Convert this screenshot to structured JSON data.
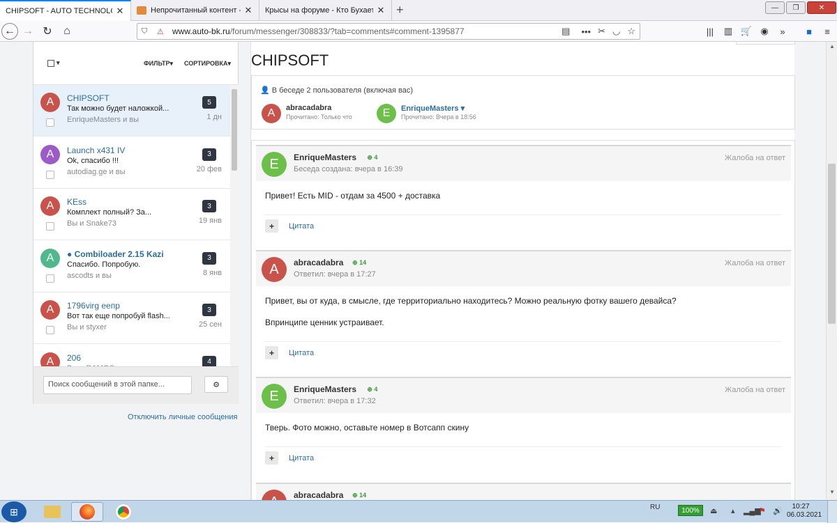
{
  "browser": {
    "tabs": [
      {
        "label": "CHIPSOFT - AUTO TECHNOLOGY",
        "active": true
      },
      {
        "label": "Непрочитанный контент - Фо",
        "active": false
      },
      {
        "label": "Крысы на форуме - Кто Бухает то",
        "active": false
      }
    ],
    "url_host": "www.auto-bk.ru",
    "url_path": "/forum/messenger/308833/?tab=comments#comment-1395877"
  },
  "sidebar": {
    "filter_label": "ФИЛЬТР",
    "sort_label": "СОРТИРОВКА",
    "conversations": [
      {
        "title": "CHIPSOFT",
        "excerpt": "Так можно будет наложкой...",
        "participants": "EnriqueMasters и вы",
        "count": "5",
        "date": "1 дн",
        "avatar": "A",
        "avatar_color": "#c9524a",
        "selected": true,
        "unread": false
      },
      {
        "title": "Launch x431 IV",
        "excerpt": "Ok, спасибо !!!",
        "participants": "autodiag.ge и вы",
        "count": "3",
        "date": "20 фев",
        "avatar": "A",
        "avatar_color": "#9c5bc8",
        "selected": false,
        "unread": false
      },
      {
        "title": "KEss",
        "excerpt": "Комплект полный? За...",
        "participants": "Вы и Snake73",
        "count": "3",
        "date": "19 янв",
        "avatar": "A",
        "avatar_color": "#c9524a",
        "selected": false,
        "unread": false
      },
      {
        "title": "● Combiloader 2.15 Kazi",
        "excerpt": "Спасибо. Попробую.",
        "participants": "ascodts и вы",
        "count": "3",
        "date": "8 янв",
        "avatar": "A",
        "avatar_color": "#4fb88c",
        "selected": false,
        "unread": true
      },
      {
        "title": "1796virg еепр",
        "excerpt": "Вот так еще попробуй flash...",
        "participants": "Вы и styxer",
        "count": "3",
        "date": "25 сен",
        "avatar": "A",
        "avatar_color": "#c9524a",
        "selected": false,
        "unread": false
      },
      {
        "title": "206",
        "excerpt": "",
        "participants": "Вы и RAMOS",
        "count": "4",
        "date": "",
        "avatar": "A",
        "avatar_color": "#c9524a",
        "selected": false,
        "unread": false
      }
    ],
    "search_placeholder": "Поиск сообщений в этой папке...",
    "disable_link": "Отключить личные сообщения"
  },
  "conversation": {
    "title": "CHIPSOFT",
    "members_header": "В беседе 2 пользователя (включая вас)",
    "members": [
      {
        "name": "abracadabra",
        "status": "Прочитано: Только что",
        "avatar": "A",
        "avatar_color": "#c9524a"
      },
      {
        "name": "EnriqueMasters ▾",
        "status": "Прочитано: Вчера в 18:56",
        "avatar": "E",
        "avatar_color": "#6cc04a"
      }
    ],
    "report_label": "Жалоба на ответ",
    "quote_label": "Цитата",
    "messages": [
      {
        "author": "EnriqueMasters",
        "rep": "⊕ 4",
        "sub": "Беседа создана: вчера в 16:39",
        "avatar": "E",
        "avatar_color": "#6cc04a",
        "body": [
          "Привет! Есть MID - отдам за 4500 + доставка"
        ]
      },
      {
        "author": "abracadabra",
        "rep": "⊕ 14",
        "sub": "Ответил: вчера в 17:27",
        "avatar": "A",
        "avatar_color": "#c9524a",
        "body": [
          "Привет, вы от куда, в смысле, где территориально находитесь? Можно реальную фотку вашего девайса?",
          "Впринципе ценник устраивает."
        ]
      },
      {
        "author": "EnriqueMasters",
        "rep": "⊕ 4",
        "sub": "Ответил: вчера в 17:32",
        "avatar": "E",
        "avatar_color": "#6cc04a",
        "body": [
          "Тверь. Фото можно, оставьте номер в Вотсапп скину"
        ]
      },
      {
        "author": "abracadabra",
        "rep": "⊕ 14",
        "sub": "",
        "avatar": "A",
        "avatar_color": "#c9524a",
        "body": []
      }
    ]
  },
  "taskbar": {
    "lang": "RU",
    "battery": "100%",
    "time": "10:27",
    "date": "06.03.2021"
  }
}
